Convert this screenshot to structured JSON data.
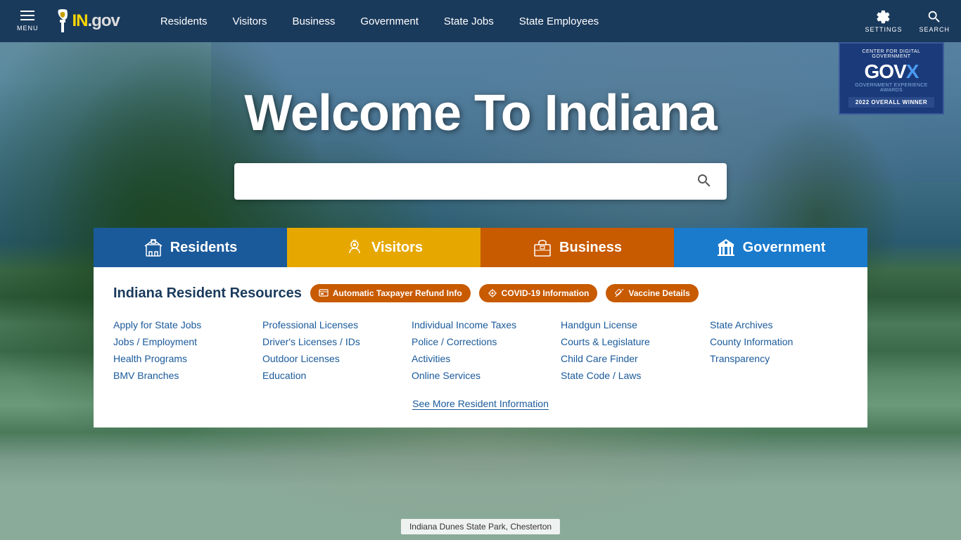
{
  "navbar": {
    "menu_label": "MENU",
    "logo_text": "IN",
    "logo_domain": ".gov",
    "nav_links": [
      {
        "label": "Residents",
        "id": "residents"
      },
      {
        "label": "Visitors",
        "id": "visitors"
      },
      {
        "label": "Business",
        "id": "business"
      },
      {
        "label": "Government",
        "id": "government"
      },
      {
        "label": "State Jobs",
        "id": "state-jobs"
      },
      {
        "label": "State Employees",
        "id": "state-employees"
      }
    ],
    "settings_label": "SETTINGS",
    "search_label": "SEARCH"
  },
  "govx_badge": {
    "top_text": "CENTER FOR DIGITAL GOVERNMENT",
    "logo": "GOV",
    "logo_x": "X",
    "sub_text": "GOVERNMENT EXPERIENCE AWARDS",
    "winner": "2022 OVERALL WINNER"
  },
  "hero": {
    "title": "Welcome To Indiana",
    "search_placeholder": ""
  },
  "tabs": [
    {
      "label": "Residents",
      "id": "residents",
      "active": true
    },
    {
      "label": "Visitors",
      "id": "visitors",
      "active": false
    },
    {
      "label": "Business",
      "id": "business",
      "active": false
    },
    {
      "label": "Government",
      "id": "government",
      "active": false
    }
  ],
  "panel": {
    "title": "Indiana Resident Resources",
    "badges": [
      {
        "label": "Automatic Taxpayer Refund Info",
        "id": "refund"
      },
      {
        "label": "COVID-19 Information",
        "id": "covid"
      },
      {
        "label": "Vaccine Details",
        "id": "vaccine"
      }
    ],
    "columns": [
      [
        {
          "label": "Apply for State Jobs"
        },
        {
          "label": "Jobs / Employment"
        },
        {
          "label": "Health Programs"
        },
        {
          "label": "BMV Branches"
        }
      ],
      [
        {
          "label": "Professional Licenses"
        },
        {
          "label": "Driver's Licenses / IDs"
        },
        {
          "label": "Outdoor Licenses"
        },
        {
          "label": "Education"
        }
      ],
      [
        {
          "label": "Individual Income Taxes"
        },
        {
          "label": "Police / Corrections"
        },
        {
          "label": "Activities"
        },
        {
          "label": "Online Services"
        }
      ],
      [
        {
          "label": "Handgun License"
        },
        {
          "label": "Courts & Legislature"
        },
        {
          "label": "Child Care Finder"
        },
        {
          "label": "State Code / Laws"
        }
      ],
      [
        {
          "label": "State Archives"
        },
        {
          "label": "County Information"
        },
        {
          "label": "Transparency"
        },
        {
          "label": ""
        }
      ]
    ],
    "see_more": "See More Resident Information"
  },
  "location_tag": "Indiana Dunes State Park, Chesterton"
}
